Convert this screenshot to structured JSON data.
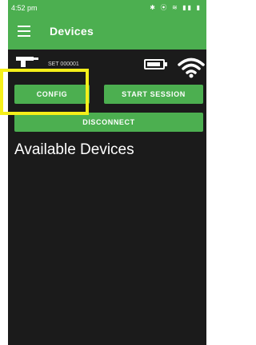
{
  "status_bar": {
    "time": "4:52 pm",
    "icons": "✱ ⦿ ≋ ▮▮ ▮"
  },
  "app_bar": {
    "title": "Devices",
    "menu_icon": "hamburger-menu-icon"
  },
  "device": {
    "name": "SET 000001",
    "icon": "drill-icon",
    "battery_icon": "battery-icon",
    "wifi_icon": "wifi-icon"
  },
  "buttons": {
    "config": "CONFIG",
    "start_session": "START SESSION",
    "disconnect": "DISCONNECT"
  },
  "section": {
    "available_devices": "Available Devices"
  },
  "colors": {
    "primary": "#4caf50",
    "background": "#1b1b1b",
    "highlight": "#f5ef1a"
  }
}
